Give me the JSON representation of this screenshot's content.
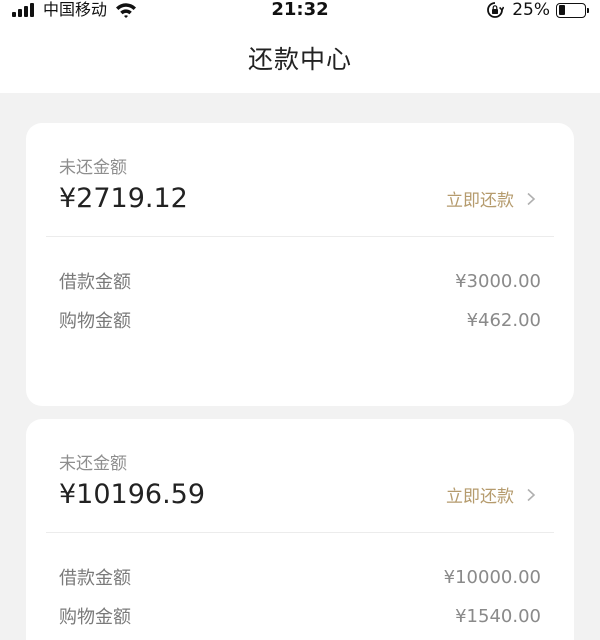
{
  "status_bar": {
    "carrier": "中国移动",
    "time": "21:32",
    "battery_percent": "25%",
    "battery_level": 0.25
  },
  "header": {
    "title": "还款中心"
  },
  "cards": [
    {
      "unpaid_label": "未还金额",
      "unpaid_amount": "¥2719.12",
      "pay_now_label": "立即还款",
      "rows": [
        {
          "label": "借款金额",
          "value": "¥3000.00"
        },
        {
          "label": "购物金额",
          "value": "¥462.00"
        }
      ]
    },
    {
      "unpaid_label": "未还金额",
      "unpaid_amount": "¥10196.59",
      "pay_now_label": "立即还款",
      "rows": [
        {
          "label": "借款金额",
          "value": "¥10000.00"
        },
        {
          "label": "购物金额",
          "value": "¥1540.00"
        }
      ]
    }
  ],
  "colors": {
    "accent": "#b59b6d",
    "background": "#f2f2f2",
    "card": "#ffffff"
  }
}
